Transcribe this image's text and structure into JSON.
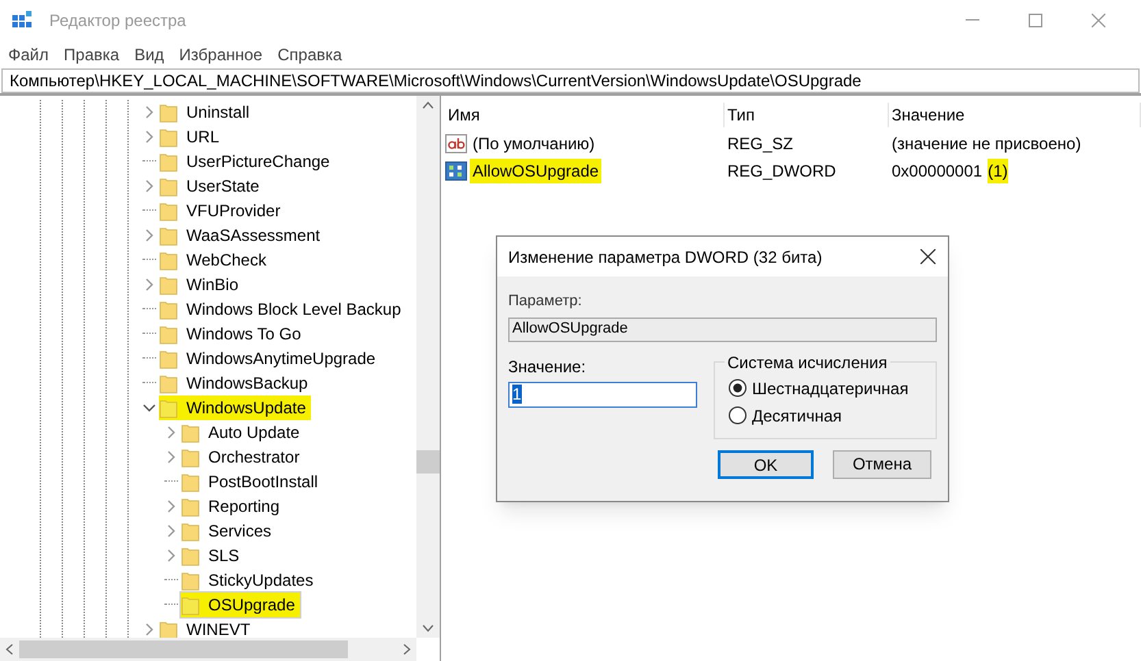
{
  "window": {
    "title": "Редактор реестра"
  },
  "menu": [
    "Файл",
    "Правка",
    "Вид",
    "Избранное",
    "Справка"
  ],
  "address": "Компьютер\\HKEY_LOCAL_MACHINE\\SOFTWARE\\Microsoft\\Windows\\CurrentVersion\\WindowsUpdate\\OSUpgrade",
  "tree": [
    {
      "label": "Uninstall",
      "has_children": true,
      "expanded": false,
      "highlighted": false,
      "selected": false
    },
    {
      "label": "URL",
      "has_children": true,
      "expanded": false,
      "highlighted": false,
      "selected": false
    },
    {
      "label": "UserPictureChange",
      "has_children": false,
      "highlighted": false,
      "selected": false
    },
    {
      "label": "UserState",
      "has_children": true,
      "expanded": false,
      "highlighted": false,
      "selected": false
    },
    {
      "label": "VFUProvider",
      "has_children": false,
      "highlighted": false,
      "selected": false
    },
    {
      "label": "WaaSAssessment",
      "has_children": true,
      "expanded": false,
      "highlighted": false,
      "selected": false
    },
    {
      "label": "WebCheck",
      "has_children": false,
      "highlighted": false,
      "selected": false
    },
    {
      "label": "WinBio",
      "has_children": true,
      "expanded": false,
      "highlighted": false,
      "selected": false
    },
    {
      "label": "Windows Block Level Backup",
      "has_children": false,
      "highlighted": false,
      "selected": false
    },
    {
      "label": "Windows To Go",
      "has_children": false,
      "highlighted": false,
      "selected": false
    },
    {
      "label": "WindowsAnytimeUpgrade",
      "has_children": false,
      "highlighted": false,
      "selected": false
    },
    {
      "label": "WindowsBackup",
      "has_children": false,
      "highlighted": false,
      "selected": false
    },
    {
      "label": "WindowsUpdate",
      "has_children": true,
      "expanded": true,
      "highlighted": true,
      "selected": false,
      "children": [
        {
          "label": "Auto Update",
          "has_children": true,
          "expanded": false,
          "highlighted": false,
          "selected": false
        },
        {
          "label": "Orchestrator",
          "has_children": true,
          "expanded": false,
          "highlighted": false,
          "selected": false
        },
        {
          "label": "PostBootInstall",
          "has_children": false,
          "highlighted": false,
          "selected": false
        },
        {
          "label": "Reporting",
          "has_children": true,
          "expanded": false,
          "highlighted": false,
          "selected": false
        },
        {
          "label": "Services",
          "has_children": true,
          "expanded": false,
          "highlighted": false,
          "selected": false
        },
        {
          "label": "SLS",
          "has_children": true,
          "expanded": false,
          "highlighted": false,
          "selected": false
        },
        {
          "label": "StickyUpdates",
          "has_children": false,
          "highlighted": false,
          "selected": false
        },
        {
          "label": "OSUpgrade",
          "has_children": false,
          "highlighted": true,
          "selected": true
        }
      ]
    },
    {
      "label": "WINEVT",
      "has_children": true,
      "expanded": false,
      "highlighted": false,
      "selected": false
    }
  ],
  "values": {
    "columns": [
      "Имя",
      "Тип",
      "Значение"
    ],
    "rows": [
      {
        "kind": "string",
        "name": "(По умолчанию)",
        "type": "REG_SZ",
        "data": "(значение не присвоено)",
        "highlighted": false
      },
      {
        "kind": "binary",
        "name": "AllowOSUpgrade",
        "type": "REG_DWORD",
        "data": "0x00000001",
        "note": "(1)",
        "highlighted": true
      }
    ]
  },
  "dialog": {
    "title": "Изменение параметра DWORD (32 бита)",
    "param_label": "Параметр:",
    "param_value": "AllowOSUpgrade",
    "value_label": "Значение:",
    "value": "1",
    "base_label": "Система исчисления",
    "bases": [
      {
        "label": "Шестнадцатеричная",
        "selected": true
      },
      {
        "label": "Десятичная",
        "selected": false
      }
    ],
    "ok": "OK",
    "cancel": "Отмена"
  }
}
